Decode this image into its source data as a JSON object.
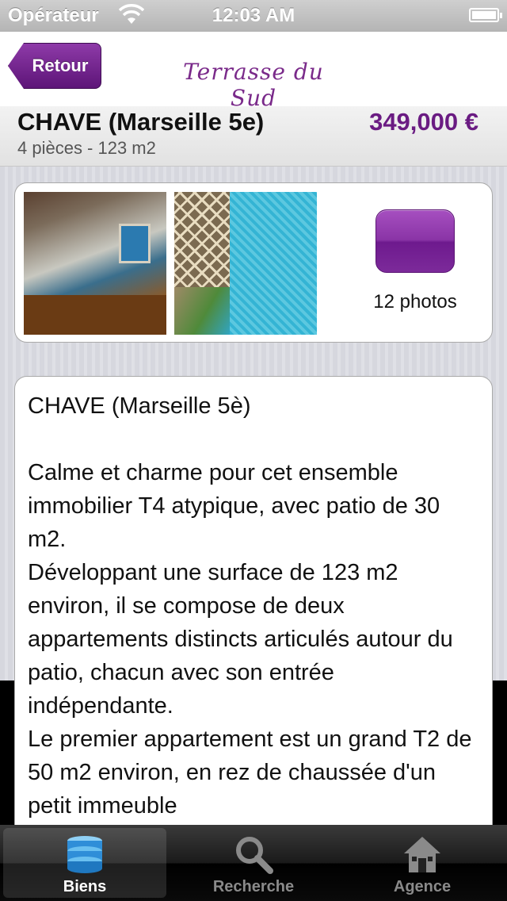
{
  "status_bar": {
    "carrier": "Opérateur",
    "time": "12:03 AM"
  },
  "nav": {
    "back_label": "Retour",
    "brand": "Terrasse du Sud"
  },
  "property": {
    "title": "CHAVE (Marseille 5e)",
    "price": "349,000 €",
    "subtitle": "4 pièces - 123 m2"
  },
  "photos": {
    "count_label": "12 photos"
  },
  "description": {
    "text": "CHAVE (Marseille 5è)\n\nCalme et charme pour cet ensemble immobilier T4 atypique, avec patio de 30 m2.\nDéveloppant une surface de 123 m2 environ, il se compose de deux appartements distincts articulés autour du patio, chacun avec son entrée indépendante.\nLe premier appartement est un grand T2 de 50 m2 environ, en rez de chaussée d'un petit immeuble"
  },
  "tabs": [
    {
      "label": "Biens",
      "icon": "database-icon",
      "active": true
    },
    {
      "label": "Recherche",
      "icon": "search-icon",
      "active": false
    },
    {
      "label": "Agence",
      "icon": "house-icon",
      "active": false
    }
  ],
  "colors": {
    "accent": "#6a1b82",
    "tab_active_icon": "#3aa0e0"
  }
}
